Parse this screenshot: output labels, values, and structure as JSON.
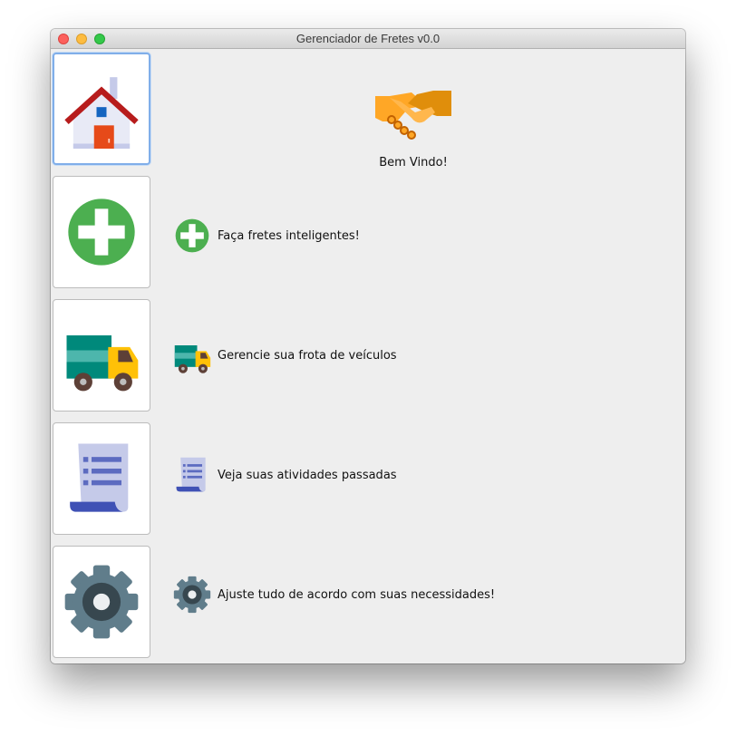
{
  "window": {
    "title": "Gerenciador de Fretes v0.0"
  },
  "sidebar": {
    "items": [
      {
        "name": "home",
        "icon": "house-icon",
        "active": true
      },
      {
        "name": "new-freight",
        "icon": "plus-circle-icon",
        "active": false
      },
      {
        "name": "fleet",
        "icon": "truck-icon",
        "active": false
      },
      {
        "name": "history",
        "icon": "document-list-icon",
        "active": false
      },
      {
        "name": "settings",
        "icon": "gear-icon",
        "active": false
      }
    ]
  },
  "main": {
    "welcome": {
      "icon": "handshake-icon",
      "text": "Bem Vindo!"
    },
    "features": [
      {
        "icon": "plus-circle-icon",
        "text": "Faça fretes inteligentes!"
      },
      {
        "icon": "truck-icon",
        "text": "Gerencie sua frota de veículos"
      },
      {
        "icon": "document-list-icon",
        "text": "Veja suas atividades passadas"
      },
      {
        "icon": "gear-icon",
        "text": "Ajuste tudo de acordo com suas necessidades!"
      }
    ]
  },
  "colors": {
    "green": "#4caf50",
    "teal": "#00897b",
    "yellow": "#ffc107",
    "doc_blue": "#3f51b5",
    "gear_gray": "#546e7a",
    "roof_red": "#b71c1c",
    "door_orange": "#e64a19",
    "handshake_orange": "#ffa726",
    "active_border": "#80aee9"
  }
}
